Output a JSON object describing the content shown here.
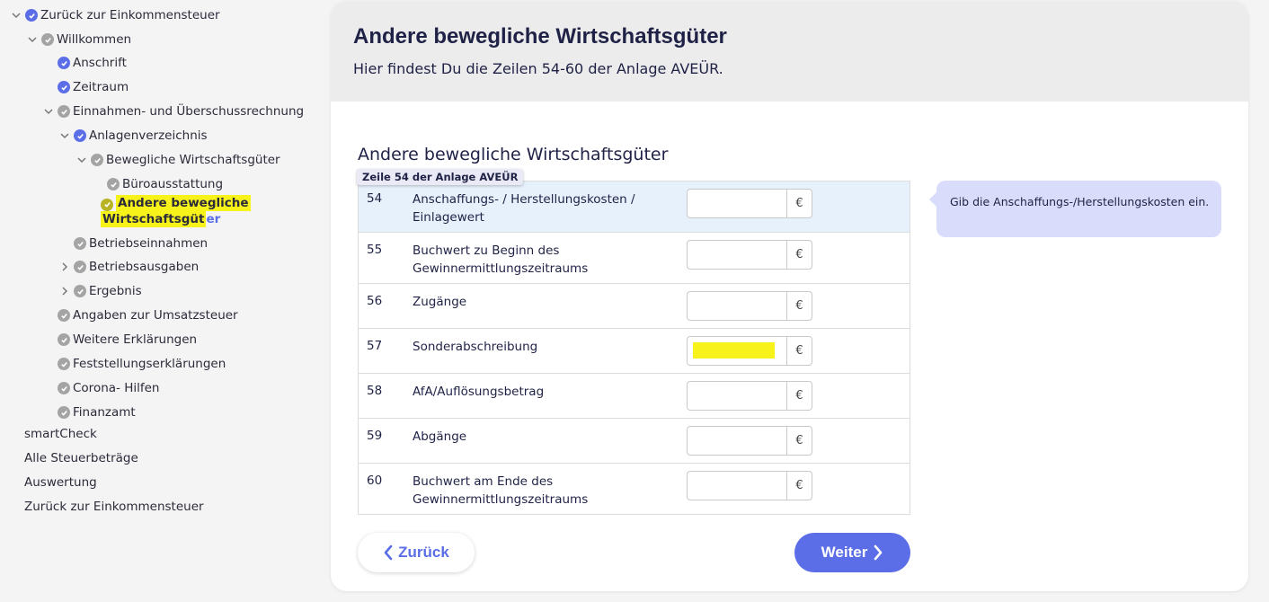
{
  "sidebar": {
    "items": [
      {
        "label": "Zurück zur Einkommensteuer",
        "level": 0,
        "chevron": "down",
        "check": "blue"
      },
      {
        "label": "Willkommen",
        "level": 1,
        "chevron": "down",
        "check": "gray"
      },
      {
        "label": "Anschrift",
        "level": 2,
        "chevron": "none",
        "check": "blue"
      },
      {
        "label": "Zeitraum",
        "level": 2,
        "chevron": "none",
        "check": "blue"
      },
      {
        "label": "Einnahmen- und Überschussrechnung",
        "level": 2,
        "chevron": "down",
        "check": "gray"
      },
      {
        "label": "Anlagenverzeichnis",
        "level": 3,
        "chevron": "down",
        "check": "blue"
      },
      {
        "label": "Bewegliche Wirtschaftsgüter",
        "level": 4,
        "chevron": "down",
        "check": "gray"
      },
      {
        "label": "Büroausstattung",
        "level": 5,
        "chevron": "none",
        "check": "gray"
      },
      {
        "label": "Betriebseinnahmen",
        "level": 3,
        "chevron": "none",
        "check": "gray"
      },
      {
        "label": "Betriebsausgaben",
        "level": 3,
        "chevron": "right",
        "check": "gray"
      },
      {
        "label": "Ergebnis",
        "level": 3,
        "chevron": "right",
        "check": "gray"
      },
      {
        "label": "Angaben zur Umsatzsteuer",
        "level": 2,
        "chevron": "none",
        "check": "gray"
      },
      {
        "label": "Weitere Erklärungen",
        "level": 2,
        "chevron": "none",
        "check": "gray"
      },
      {
        "label": "Feststellungserklärungen",
        "level": 2,
        "chevron": "none",
        "check": "gray"
      },
      {
        "label": "Corona- Hilfen",
        "level": 2,
        "chevron": "none",
        "check": "gray"
      },
      {
        "label": "Finanzamt",
        "level": 2,
        "chevron": "none",
        "check": "gray"
      }
    ],
    "active": {
      "line1": "Andere bewegliche",
      "line2": "Wirtschaftsgüt",
      "line2_tail": "er"
    },
    "bottom_links": [
      "smartCheck",
      "Alle Steuerbeträge",
      "Auswertung",
      "Zurück zur Einkommensteuer"
    ]
  },
  "header": {
    "title": "Andere bewegliche Wirtschaftsgüter",
    "subtitle": "Hier findest Du die Zeilen 54-60 der Anlage AVEÜR."
  },
  "section": {
    "title": "Andere bewegliche Wirtschaftsgüter",
    "tag": "Zeile 54 der Anlage AVEÜR"
  },
  "rows": [
    {
      "num": "54",
      "label": "Anschaffungs- / Herstellungskosten / Einlagewert",
      "value": ""
    },
    {
      "num": "55",
      "label": "Buchwert zu Beginn des Gewinnermittlungszeitraums",
      "value": ""
    },
    {
      "num": "56",
      "label": "Zugänge",
      "value": ""
    },
    {
      "num": "57",
      "label": "Sonderabschreibung",
      "value": ""
    },
    {
      "num": "58",
      "label": "AfA/Auflösungsbetrag",
      "value": ""
    },
    {
      "num": "59",
      "label": "Abgänge",
      "value": ""
    },
    {
      "num": "60",
      "label": "Buchwert am Ende des Gewinnermittlungszeitraums",
      "value": ""
    }
  ],
  "currency": "€",
  "tooltip": "Gib die Anschaffungs-/Herstellungskosten ein.",
  "buttons": {
    "back": "Zurück",
    "next": "Weiter"
  },
  "colors": {
    "accent": "#5b6ee8",
    "highlight": "#f7f21a",
    "tooltip_bg": "#d9ddfb"
  }
}
